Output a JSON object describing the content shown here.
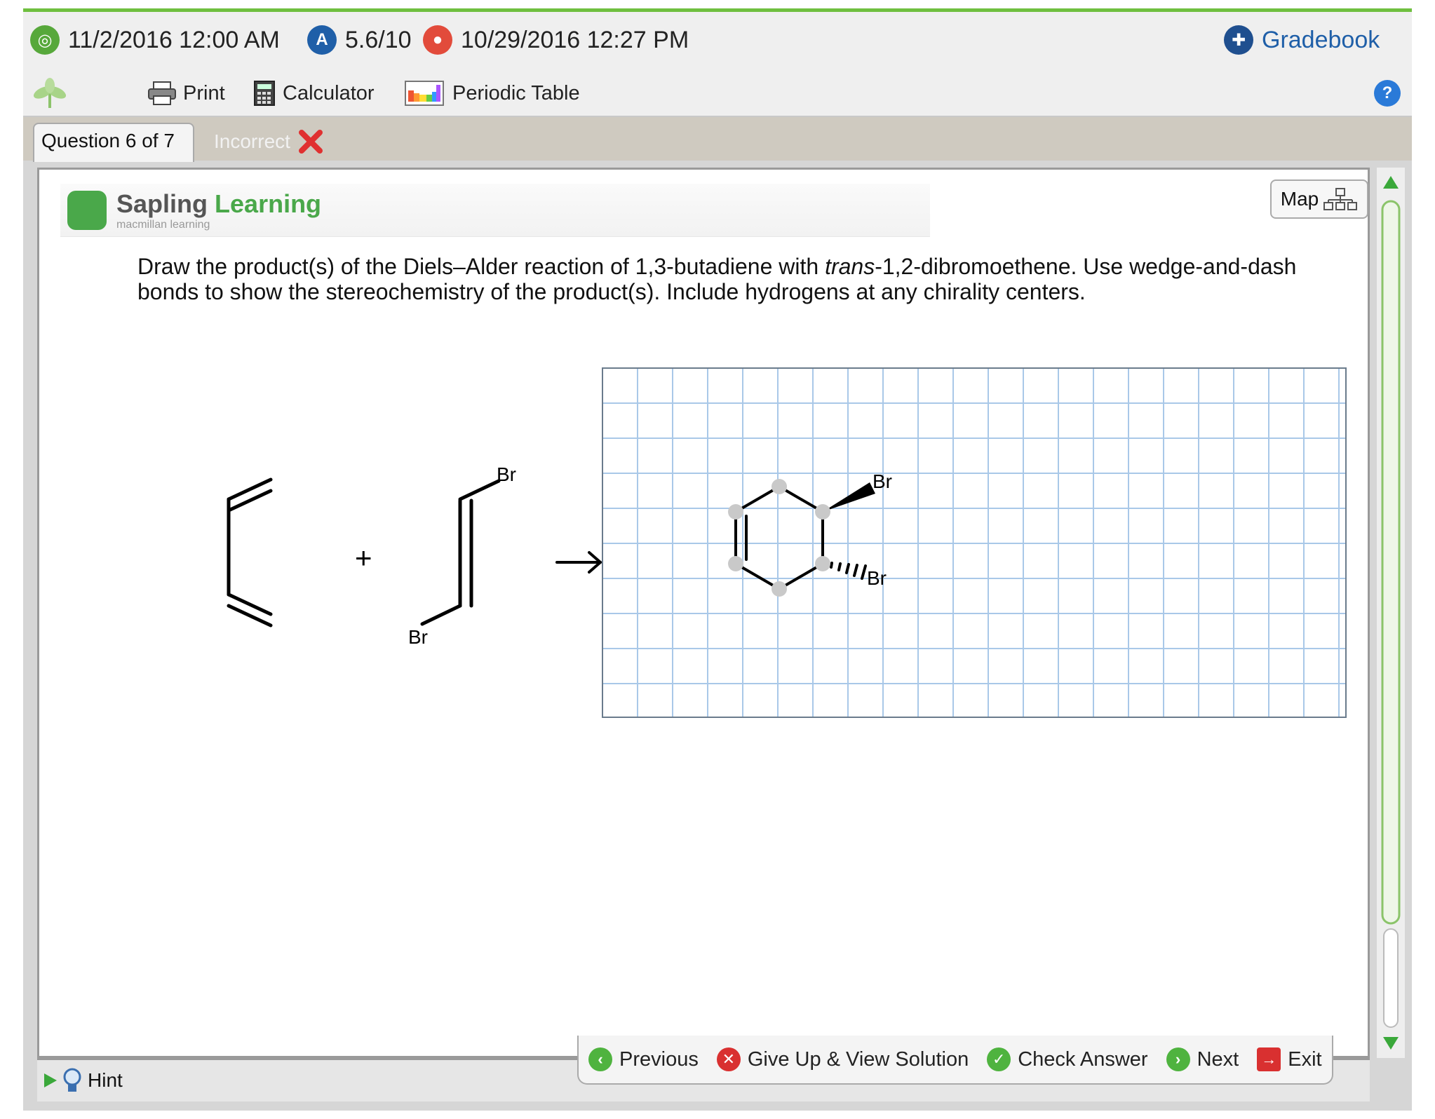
{
  "topbar": {
    "due_date": "11/2/2016 12:00 AM",
    "score": "5.6/10",
    "submitted": "10/29/2016 12:27 PM",
    "gradebook": "Gradebook"
  },
  "toolbar": {
    "print": "Print",
    "calculator": "Calculator",
    "periodic_table": "Periodic Table"
  },
  "tabs": {
    "question": "Question 6 of 7",
    "status": "Incorrect"
  },
  "brand": {
    "name_part1": "Sapling",
    "name_part2": "Learning",
    "sub": "macmillan learning"
  },
  "map_label": "Map",
  "question": {
    "text_before": "Draw the product(s) of the Diels–Alder reaction of 1,3-butadiene with ",
    "italic": "trans",
    "text_after": "-1,2-dibromoethene. Use wedge-and-dash bonds to show the stereochemistry of the product(s). Include hydrogens at any chirality centers."
  },
  "reaction": {
    "plus": "+",
    "br_top": "Br",
    "br_bottom": "Br"
  },
  "product": {
    "br_wedge": "Br",
    "br_dash": "Br"
  },
  "bottom": {
    "hint": "Hint",
    "previous": "Previous",
    "give_up": "Give Up & View Solution",
    "check": "Check Answer",
    "next": "Next",
    "exit": "Exit"
  },
  "colors": {
    "accent_green": "#6fbf3f",
    "brand_green": "#4aa84a",
    "link_blue": "#1f5fa8",
    "incorrect_red": "#e03030",
    "grid_blue": "#a9c8e8"
  }
}
